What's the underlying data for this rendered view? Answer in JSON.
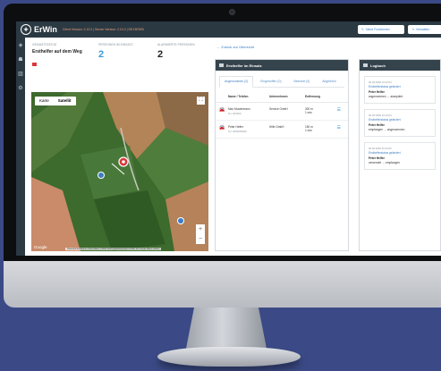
{
  "app": {
    "name": "ErWin",
    "version": "Client Version: 2.10.2 | Server Version: 2.10.2 | DE13E5E6",
    "buttons": {
      "new_functions": "Neue Funktionen",
      "manage": "Verwalten"
    }
  },
  "stats": [
    {
      "label": "Gesamtstatus",
      "value": "Ersthelfer auf dem Weg"
    },
    {
      "label": "Personen im Einsatz",
      "value": "2"
    },
    {
      "label": "Alarmierte Personen",
      "value": "2"
    }
  ],
  "map": {
    "type_options": [
      "Karte",
      "Satellit"
    ],
    "zoom_in": "+",
    "zoom_out": "−",
    "provider": "Google",
    "attribution": "Tastenkombinationen  Kartendaten ©2024  Nutzungsbedingungen  Fehler bei Google Maps melden"
  },
  "back_link": "Zurück zur Übersicht",
  "einsatz": {
    "title": "Ersthelfer im Einsatz",
    "tabs": [
      "Angenommen (2)",
      "Eingetroffen (0)",
      "Beendet (0)",
      "Abgelehnt"
    ],
    "columns": [
      "Name / Telefon",
      "Unternehmen",
      "Entfernung"
    ],
    "rows": [
      {
        "name": "Max Mustermann",
        "phone": "Tel. 000000",
        "company": "Service GmbH",
        "distance": "300 m",
        "time": "1 min"
      },
      {
        "name": "Peter Helfer",
        "phone": "Tel. 0000000000",
        "company": "Hilfe GmbH",
        "distance": "150 m",
        "time": "1 min"
      }
    ]
  },
  "log": {
    "title": "Logbuch",
    "entries": [
      {
        "date": "00.00.0000 15:10:03",
        "title": "Ersthelferstatus geändert",
        "name": "Peter Helfer",
        "status": "angenommen → akzeptiert"
      },
      {
        "date": "00.00.0000 15:10:04",
        "title": "Ersthelferstatus geändert",
        "name": "Peter Helfer",
        "status": "empfangen → angenommen"
      },
      {
        "date": "00.00.0000 15:10:06",
        "title": "Ersthelferstatus geändert",
        "name": "Peter Helfer",
        "status": "versendet → empfangen"
      }
    ]
  }
}
